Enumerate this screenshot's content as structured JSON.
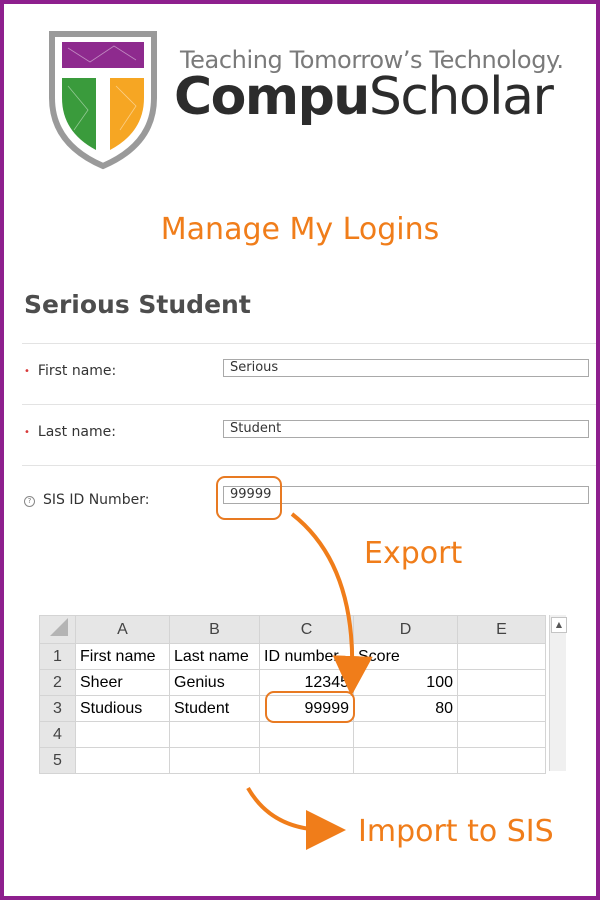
{
  "logo": {
    "tagline": "Teaching Tomorrow’s Technology.",
    "brand_bold": "Compu",
    "brand_regular": "Scholar",
    "colors": {
      "top": "#8e2a8e",
      "left": "#3a9b3c",
      "right": "#f6a623",
      "frame": "#9a9a9a"
    }
  },
  "heading": "Manage My Logins",
  "student": {
    "name": "Serious Student",
    "fields": [
      {
        "label": "First name:",
        "value": "Serious",
        "marker": "required"
      },
      {
        "label": "Last name:",
        "value": "Student",
        "marker": "required"
      },
      {
        "label": "SIS ID Number:",
        "value": "99999",
        "marker": "help"
      }
    ]
  },
  "annotations": {
    "export": "Export",
    "import": "Import to SIS",
    "accent": "#f07d1a"
  },
  "spreadsheet": {
    "columns": [
      "A",
      "B",
      "C",
      "D",
      "E"
    ],
    "rows": [
      {
        "num": "1",
        "cells": [
          "First name",
          "Last name",
          "ID number",
          "Score",
          ""
        ]
      },
      {
        "num": "2",
        "cells": [
          "Sheer",
          "Genius",
          "12345",
          "100",
          ""
        ]
      },
      {
        "num": "3",
        "cells": [
          "Studious",
          "Student",
          "99999",
          "80",
          ""
        ]
      },
      {
        "num": "4",
        "cells": [
          "",
          "",
          "",
          "",
          ""
        ]
      },
      {
        "num": "5",
        "cells": [
          "",
          "",
          "",
          "",
          ""
        ]
      }
    ]
  }
}
